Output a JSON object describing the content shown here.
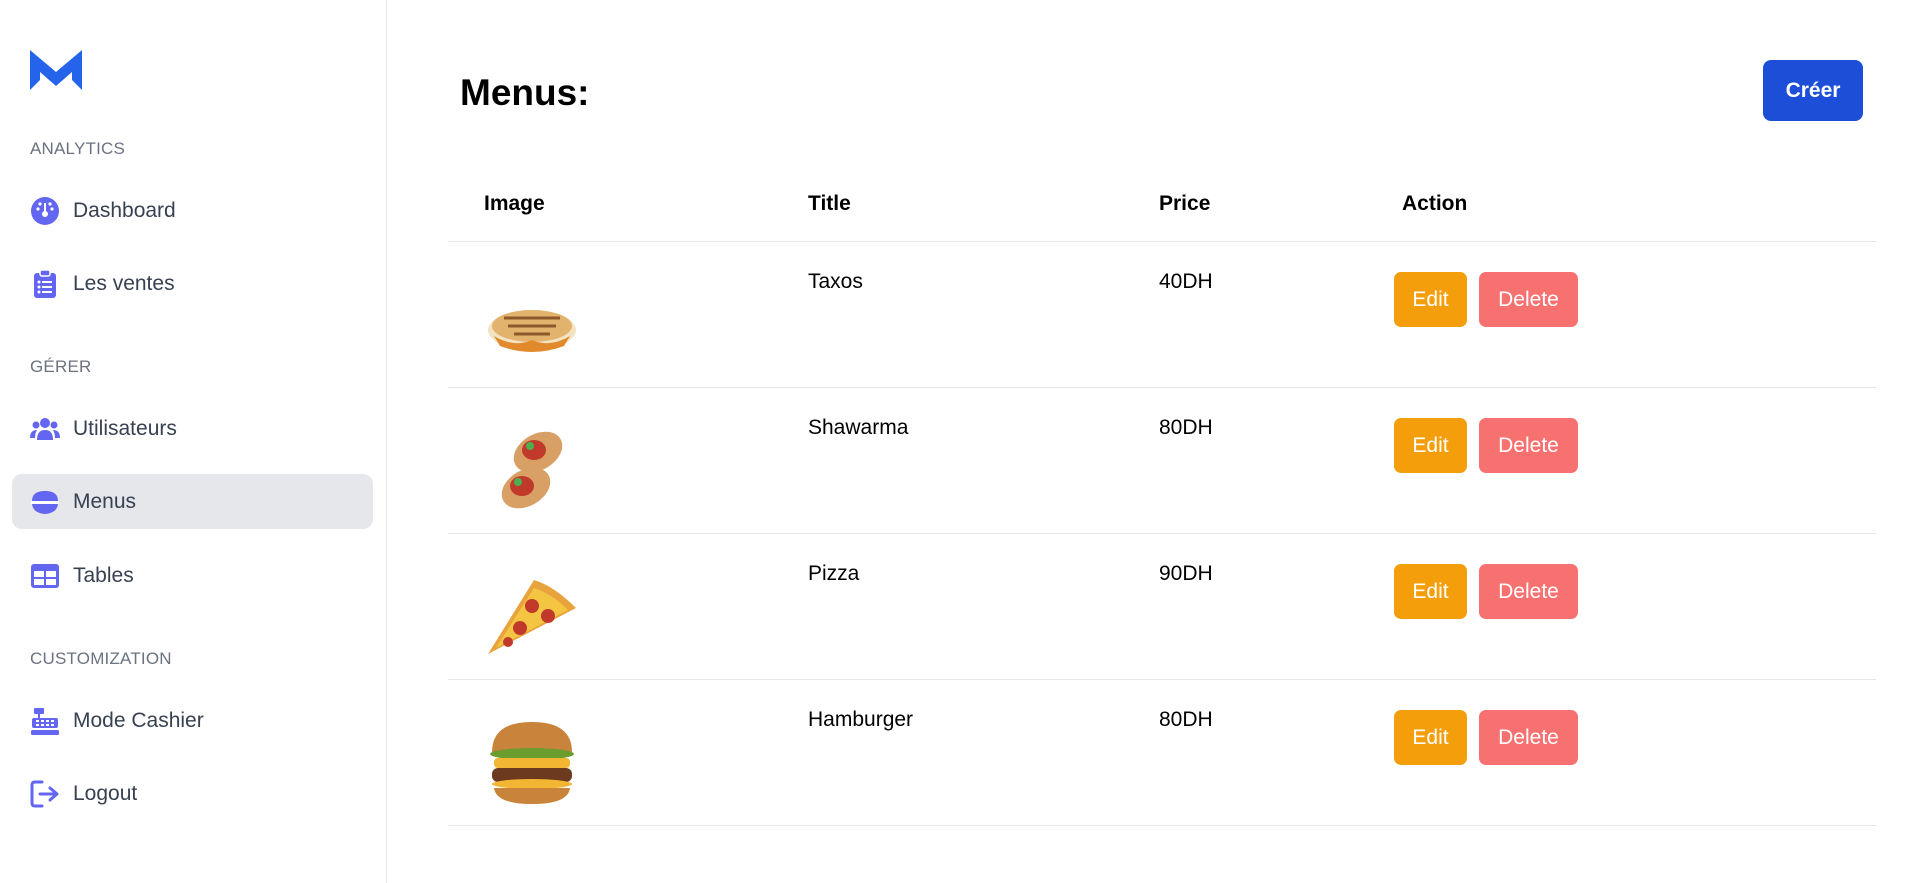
{
  "sidebar": {
    "logo": "M",
    "sections": [
      {
        "label": "ANALYTICS"
      },
      {
        "label": "GÉRER"
      },
      {
        "label": "CUSTOMIZATION"
      }
    ],
    "items": [
      {
        "label": "Dashboard",
        "icon": "dashboard-icon"
      },
      {
        "label": "Les ventes",
        "icon": "clipboard-list-icon"
      },
      {
        "label": "Utilisateurs",
        "icon": "users-icon"
      },
      {
        "label": "Menus",
        "icon": "bowl-icon",
        "active": true
      },
      {
        "label": "Tables",
        "icon": "table-icon"
      },
      {
        "label": "Mode Cashier",
        "icon": "cash-register-icon"
      },
      {
        "label": "Logout",
        "icon": "logout-icon"
      }
    ]
  },
  "main": {
    "title": "Menus:",
    "create_label": "Créer",
    "columns": [
      "Image",
      "Title",
      "Price",
      "Action"
    ],
    "rows": [
      {
        "title": "Taxos",
        "price": "40DH",
        "image": "taxos-image"
      },
      {
        "title": "Shawarma",
        "price": "80DH",
        "image": "shawarma-image"
      },
      {
        "title": "Pizza",
        "price": "90DH",
        "image": "pizza-image"
      },
      {
        "title": "Hamburger",
        "price": "80DH",
        "image": "hamburger-image"
      }
    ],
    "edit_label": "Edit",
    "delete_label": "Delete"
  },
  "colors": {
    "accent": "#1d4ed8",
    "icon": "#6366f1",
    "edit": "#f59e0b",
    "delete": "#f87171"
  }
}
